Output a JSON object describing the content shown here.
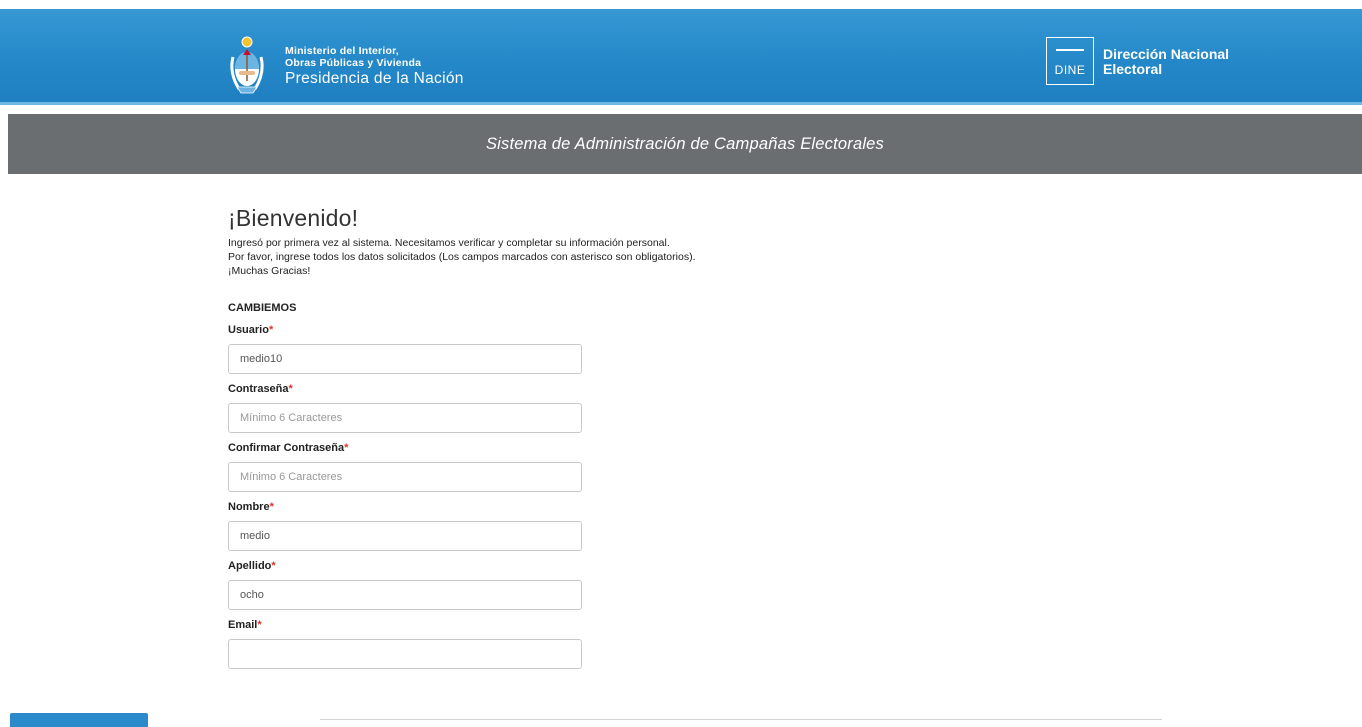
{
  "header": {
    "ministry_line1": "Ministerio del Interior,",
    "ministry_line2": "Obras Públicas y Vivienda",
    "ministry_line3": "Presidencia de la Nación",
    "dine_badge": "DINE",
    "dine_line1": "Dirección Nacional",
    "dine_line2": "Electoral"
  },
  "title_bar": {
    "text": "Sistema de Administración de Campañas Electorales"
  },
  "welcome": {
    "title": "¡Bienvenido!",
    "line1": "Ingresó por primera vez al sistema. Necesitamos verificar y completar su información personal.",
    "line2": "Por favor, ingrese todos los datos solicitados (Los campos marcados con asterisco son obligatorios).",
    "line3": "¡Muchas Gracias!"
  },
  "form": {
    "party": "CAMBIEMOS",
    "required_mark": "*",
    "fields": [
      {
        "label": "Usuario",
        "value": "medio10",
        "placeholder": ""
      },
      {
        "label": "Contraseña",
        "value": "",
        "placeholder": "Mínimo 6 Caracteres"
      },
      {
        "label": "Confirmar Contraseña",
        "value": "",
        "placeholder": "Mínimo 6 Caracteres"
      },
      {
        "label": "Nombre",
        "value": "medio",
        "placeholder": ""
      },
      {
        "label": "Apellido",
        "value": "ocho",
        "placeholder": ""
      },
      {
        "label": "Email",
        "value": "",
        "placeholder": ""
      }
    ]
  },
  "colors": {
    "header_blue": "#2488c8",
    "title_bar_grey": "#6b6e71",
    "required_red": "#e0322c"
  }
}
